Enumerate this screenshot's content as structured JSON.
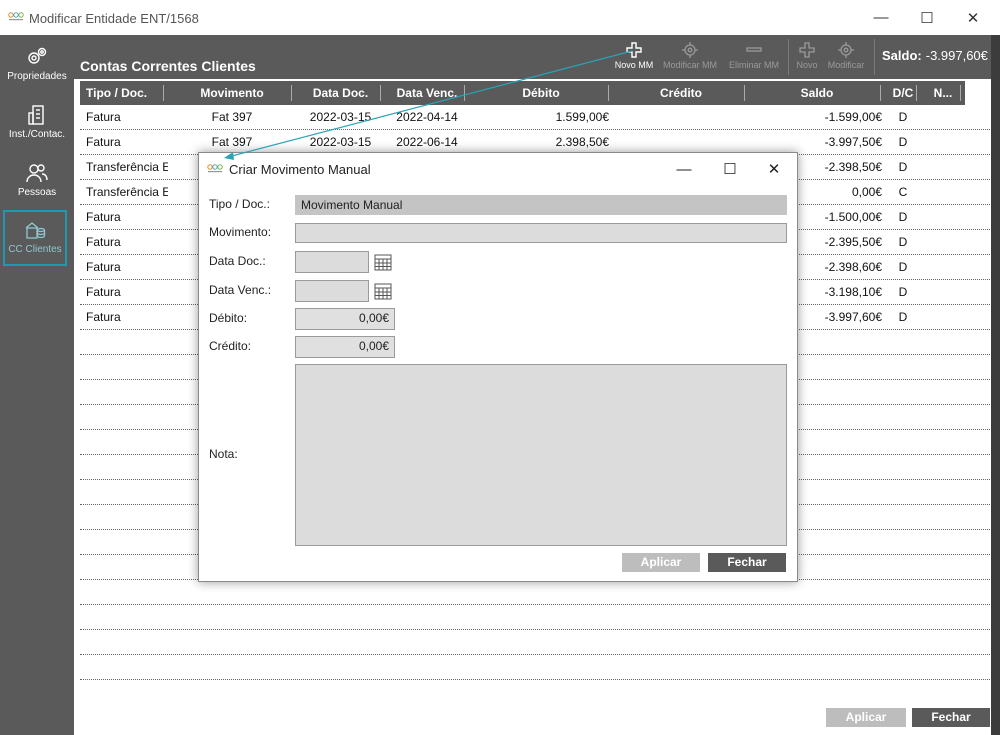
{
  "window": {
    "title": "Modificar Entidade ENT/1568"
  },
  "sidebar": {
    "items": [
      {
        "label": "Propriedades",
        "icon": "gear-cog-icon"
      },
      {
        "label": "Inst./Contac.",
        "icon": "building-icon"
      },
      {
        "label": "Pessoas",
        "icon": "people-icon"
      },
      {
        "label": "CC Clientes",
        "icon": "accounts-icon"
      }
    ]
  },
  "main": {
    "title": "Contas Correntes Clientes",
    "toolbar": {
      "novo_mm": "Novo MM",
      "modificar_mm": "Modificar MM",
      "eliminar_mm": "Eliminar MM",
      "novo": "Novo",
      "modificar": "Modificar"
    },
    "saldo_label": "Saldo:",
    "saldo_value": "-3.997,60€",
    "columns": [
      "Tipo / Doc.",
      "Movimento",
      "Data Doc.",
      "Data Venc.",
      "Débito",
      "Crédito",
      "Saldo",
      "D/C",
      "N..."
    ],
    "rows": [
      {
        "tipo": "Fatura",
        "mov": "Fat 397",
        "ddoc": "2022-03-15",
        "dvenc": "2022-04-14",
        "debito": "1.599,00€",
        "credito": "",
        "saldo": "-1.599,00€",
        "dc": "D"
      },
      {
        "tipo": "Fatura",
        "mov": "Fat 397",
        "ddoc": "2022-03-15",
        "dvenc": "2022-06-14",
        "debito": "2.398,50€",
        "credito": "",
        "saldo": "-3.997,50€",
        "dc": "D"
      },
      {
        "tipo": "Transferência E",
        "mov": "",
        "ddoc": "",
        "dvenc": "",
        "debito": "",
        "credito": "",
        "saldo": "-2.398,50€",
        "dc": "D"
      },
      {
        "tipo": "Transferência E",
        "mov": "",
        "ddoc": "",
        "dvenc": "",
        "debito": "",
        "credito": "",
        "saldo": "0,00€",
        "dc": "C"
      },
      {
        "tipo": "Fatura",
        "mov": "",
        "ddoc": "",
        "dvenc": "",
        "debito": "",
        "credito": "",
        "saldo": "-1.500,00€",
        "dc": "D"
      },
      {
        "tipo": "Fatura",
        "mov": "",
        "ddoc": "",
        "dvenc": "",
        "debito": "",
        "credito": "",
        "saldo": "-2.395,50€",
        "dc": "D"
      },
      {
        "tipo": "Fatura",
        "mov": "",
        "ddoc": "",
        "dvenc": "",
        "debito": "",
        "credito": "",
        "saldo": "-2.398,60€",
        "dc": "D"
      },
      {
        "tipo": "Fatura",
        "mov": "",
        "ddoc": "",
        "dvenc": "",
        "debito": "",
        "credito": "",
        "saldo": "-3.198,10€",
        "dc": "D"
      },
      {
        "tipo": "Fatura",
        "mov": "",
        "ddoc": "",
        "dvenc": "",
        "debito": "",
        "credito": "",
        "saldo": "-3.997,60€",
        "dc": "D"
      }
    ],
    "aplicar": "Aplicar",
    "fechar": "Fechar"
  },
  "dialog": {
    "title": "Criar Movimento Manual",
    "labels": {
      "tipo": "Tipo / Doc.:",
      "movimento": "Movimento:",
      "data_doc": "Data Doc.:",
      "data_venc": "Data Venc.:",
      "debito": "Débito:",
      "credito": "Crédito:",
      "nota": "Nota:"
    },
    "values": {
      "tipo": "Movimento Manual",
      "movimento": "",
      "data_doc": "",
      "data_venc": "",
      "debito": "0,00€",
      "credito": "0,00€",
      "nota": ""
    },
    "aplicar": "Aplicar",
    "fechar": "Fechar"
  },
  "colors": {
    "accent": "#1e9ab0",
    "panel": "#5a5a5a",
    "button_light": "#bdbdbd"
  }
}
